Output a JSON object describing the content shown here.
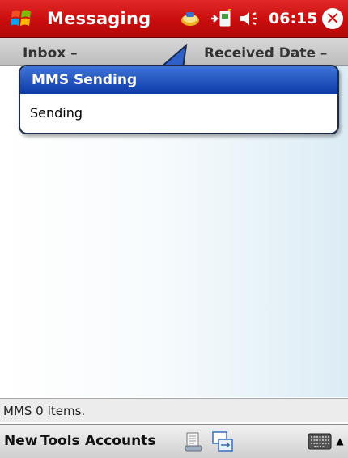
{
  "titlebar": {
    "app_title": "Messaging",
    "time": "06:15",
    "close_symbol": "✕",
    "icons": [
      "start-logo-icon",
      "notification-icon",
      "connectivity-icon",
      "speaker-icon",
      "close-icon"
    ],
    "color": "#d01414"
  },
  "header": {
    "folder_label": "Inbox –",
    "sort_label": "Received Date –"
  },
  "popup": {
    "title": "MMS Sending",
    "message": "Sending",
    "title_color": "#1e4fc0"
  },
  "status": {
    "text": "MMS  0 Items."
  },
  "menubar": {
    "items": [
      "New",
      "Tools",
      "Accounts"
    ],
    "icons": [
      "document-icon",
      "forward-icon",
      "keyboard-icon",
      "up-arrow-icon"
    ],
    "arrow": "▲"
  }
}
